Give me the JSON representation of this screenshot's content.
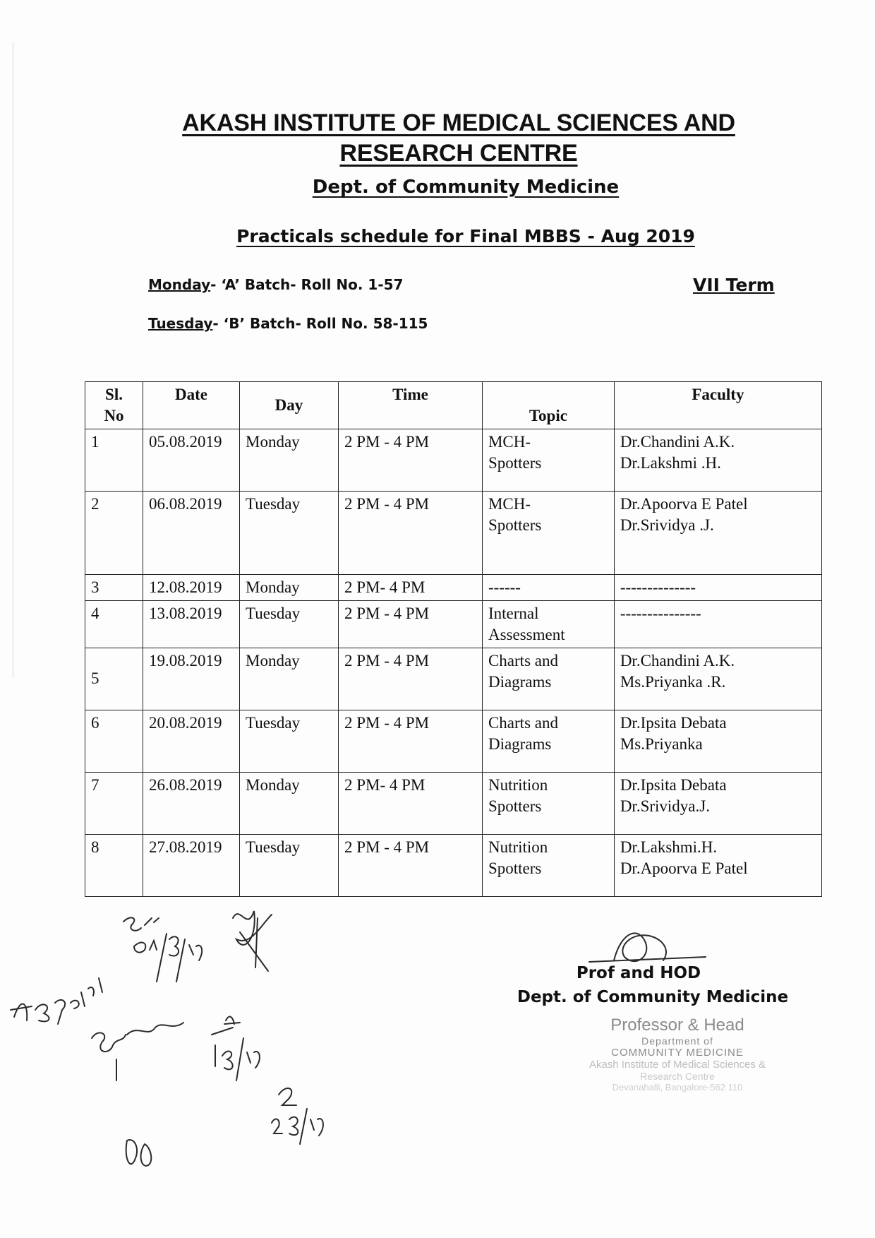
{
  "header": {
    "institute_line1": "AKASH INSTITUTE OF MEDICAL SCIENCES AND",
    "institute_line2": "RESEARCH CENTRE",
    "department": "Dept. of Community Medicine",
    "schedule_title": "Practicals schedule for Final MBBS - Aug 2019"
  },
  "batches": {
    "monday_day": "Monday",
    "monday_rest": "- ‘A’ Batch- Roll No. 1-57",
    "tuesday_day": "Tuesday",
    "tuesday_rest": "- ‘B’ Batch- Roll No. 58-115",
    "term": "VII Term"
  },
  "table": {
    "headers": {
      "sl_line1": "Sl.",
      "sl_line2": "No",
      "date": "Date",
      "day": "Day",
      "time": "Time",
      "topic": "Topic",
      "faculty": "Faculty"
    },
    "rows": [
      {
        "sl": "1",
        "date": "05.08.2019",
        "day": "Monday",
        "time": "2 PM - 4 PM",
        "topic1": "MCH-",
        "topic2": "Spotters",
        "fac1": "Dr.Chandini A.K.",
        "fac2": "Dr.Lakshmi .H."
      },
      {
        "sl": "2",
        "date": "06.08.2019",
        "day": "Tuesday",
        "time": "2 PM - 4 PM",
        "topic1": "MCH-",
        "topic2": "Spotters",
        "fac1": "Dr.Apoorva E Patel",
        "fac2": "Dr.Srividya .J."
      },
      {
        "sl": "3",
        "date": "12.08.2019",
        "day": "Monday",
        "time": "2 PM- 4 PM",
        "topic1": "------",
        "topic2": "",
        "fac1": "--------------",
        "fac2": ""
      },
      {
        "sl": "4",
        "date": "13.08.2019",
        "day": "Tuesday",
        "time": "2 PM - 4 PM",
        "topic1": "Internal",
        "topic2": "Assessment",
        "fac1": "---------------",
        "fac2": ""
      },
      {
        "sl": "5",
        "date": "19.08.2019",
        "day": "Monday",
        "time": "2 PM - 4 PM",
        "topic1": "Charts and",
        "topic2": "Diagrams",
        "fac1": "Dr.Chandini A.K.",
        "fac2": "Ms.Priyanka .R."
      },
      {
        "sl": "6",
        "date": "20.08.2019",
        "day": "Tuesday",
        "time": "2 PM - 4 PM",
        "topic1": "Charts and",
        "topic2": "Diagrams",
        "fac1": "Dr.Ipsita Debata",
        "fac2": "Ms.Priyanka"
      },
      {
        "sl": "7",
        "date": "26.08.2019",
        "day": "Monday",
        "time": "2 PM- 4 PM",
        "topic1": "Nutrition",
        "topic2": "Spotters",
        "fac1": "Dr.Ipsita Debata",
        "fac2": "Dr.Srividya.J."
      },
      {
        "sl": "8",
        "date": "27.08.2019",
        "day": "Tuesday",
        "time": "2 PM - 4 PM",
        "topic1": "Nutrition",
        "topic2": "Spotters",
        "fac1": "Dr.Lakshmi.H.",
        "fac2": "Dr.Apoorva E Patel"
      }
    ]
  },
  "signature": {
    "title": "Prof and HOD",
    "dept": "Dept. of Community Medicine"
  },
  "stamp": {
    "line1": "Professor & Head",
    "line2": "Department of",
    "line3": "COMMUNITY MEDICINE",
    "line4": "Akash Institute of Medical Sciences &",
    "line5": "Research Centre",
    "line6": "Devanahalli, Bangalore-562 110"
  },
  "handwritten": {
    "note1": "Sri 01/8/19",
    "note2": "1/8/19",
    "note3": "2/8/19"
  }
}
